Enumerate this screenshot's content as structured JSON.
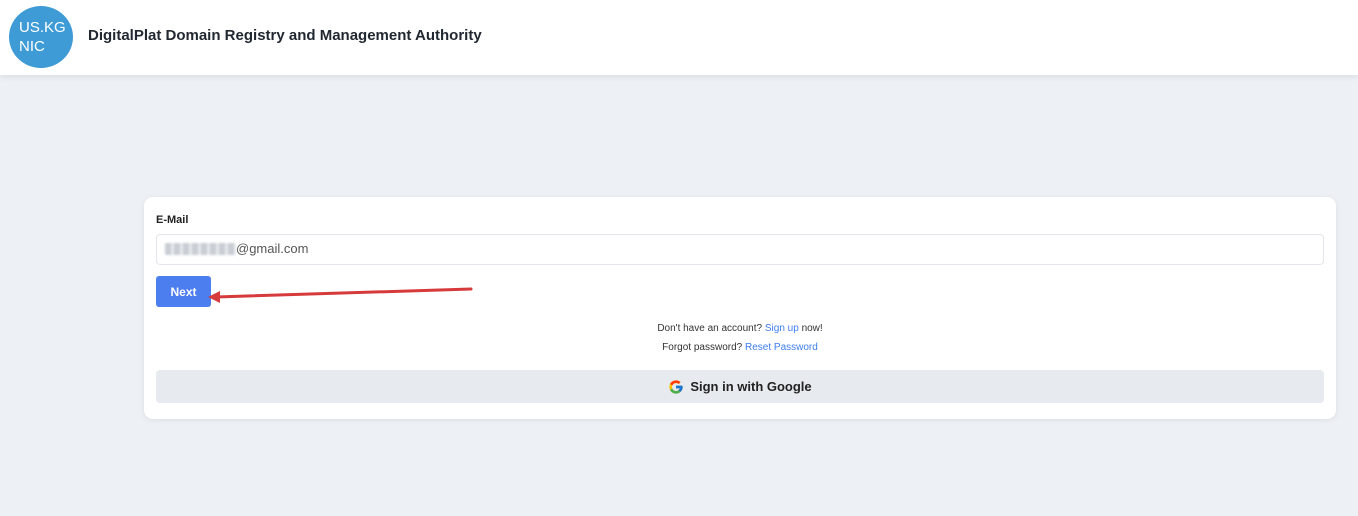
{
  "header": {
    "logo_line1": "US.KG",
    "logo_line2": "NIC",
    "title": "DigitalPlat Domain Registry and Management Authority"
  },
  "login": {
    "email_label": "E-Mail",
    "email_value_visible": "@gmail.com",
    "next_label": "Next",
    "signup_prefix": "Don't have an account?",
    "signup_link": "Sign up",
    "signup_suffix": "now!",
    "forgot_prefix": "Forgot password?",
    "reset_link": "Reset Password",
    "google_label": "Sign in with Google"
  },
  "colors": {
    "accent": "#4d7ef0",
    "link": "#3e7ef2",
    "annotation_arrow": "#d63a3a",
    "logo_bg": "#3e9bd6"
  },
  "icons": [
    "google-icon",
    "annotation-arrow"
  ]
}
